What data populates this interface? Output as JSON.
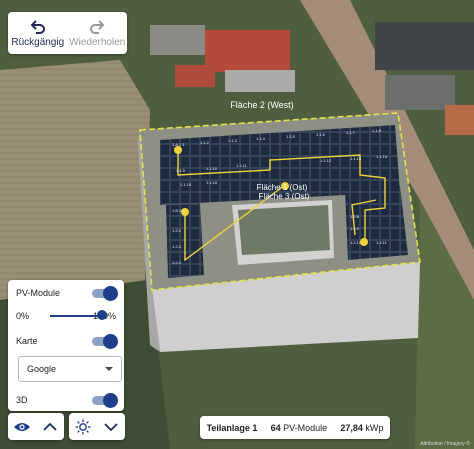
{
  "toolbar": {
    "undo_label": "Rückgängig",
    "redo_label": "Wiederholen"
  },
  "map": {
    "roof_area_west": "Fläche 2 (West)",
    "roof_area_ost_a": "Fläche 1 (Ost)",
    "roof_area_ost_b": "Fläche 3 (Ost)",
    "module_labels": [
      "1.A 1.1",
      "1.1.2",
      "1.1.3",
      "1.1.4",
      "1.1.5",
      "1.1.6",
      "1.1.7",
      "1.1.8",
      "1.1.9",
      "1.1.10",
      "1.1.11",
      "1.1.12",
      "1.1.13",
      "1.1.14",
      "1.1.15",
      "1.1.16",
      "1.B 2.1",
      "1.2.2",
      "1.2.3",
      "1.2.4",
      "1.2.8",
      "1.2.9",
      "1.2.10",
      "1.2.11"
    ],
    "copyright": "Attribution / Imagery ©"
  },
  "layers": {
    "pv_modules_label": "PV-Module",
    "opacity_min": "0%",
    "opacity_max": "100%",
    "opacity_value": 1.0,
    "map_label": "Karte",
    "map_source": "Google",
    "three_d_label": "3D"
  },
  "status": {
    "subsystem": "Teilanlage 1",
    "module_count": "64",
    "module_unit": "PV-Module",
    "power": "27,84",
    "power_unit": "kWp"
  },
  "colors": {
    "accent": "#1e3f8a",
    "roof_outline": "#e2e24a",
    "string_line": "#f0d23a"
  },
  "icons": {
    "undo": "undo-icon",
    "redo": "redo-icon",
    "view": "eye-icon",
    "light": "sun-icon",
    "expand": "chevron-up-icon",
    "collapse": "chevron-down-icon"
  }
}
